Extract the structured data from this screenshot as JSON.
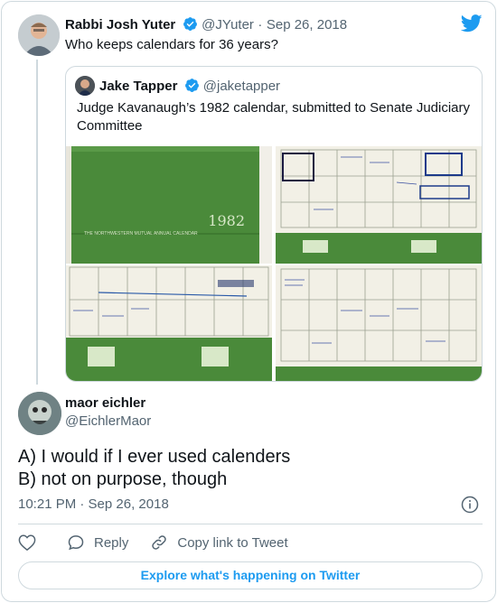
{
  "colors": {
    "accent": "#1d9bf0",
    "text": "#0f1419",
    "muted": "#536471",
    "border": "#cfd9de",
    "calendar_green": "#4a8a3a"
  },
  "parent": {
    "name": "Rabbi Josh Yuter",
    "handle": "@JYuter",
    "separator": "·",
    "date": "Sep 26, 2018",
    "text": "Who keeps calendars for 36 years?"
  },
  "quote": {
    "name": "Jake Tapper",
    "handle": "@jaketapper",
    "text": "Judge Kavanaugh’s 1982 calendar, submitted to Senate Judiciary Committee",
    "cover_year": "1982",
    "cover_caption": "THE NORTHWESTERN MUTUAL ANNUAL CALENDAR",
    "images": [
      {
        "alt": "calendar-cover"
      },
      {
        "alt": "calendar-page-1"
      },
      {
        "alt": "calendar-page-2"
      },
      {
        "alt": "calendar-page-3"
      }
    ]
  },
  "reply": {
    "name": "maor eichler",
    "handle": "@EichlerMaor",
    "text_line1": "A) I would if I ever used calenders",
    "text_line2": "B) not on purpose, though",
    "time": "10:21 PM · Sep 26, 2018"
  },
  "actions": {
    "reply_label": "Reply",
    "copy_label": "Copy link to Tweet"
  },
  "explore_label": "Explore what's happening on Twitter"
}
